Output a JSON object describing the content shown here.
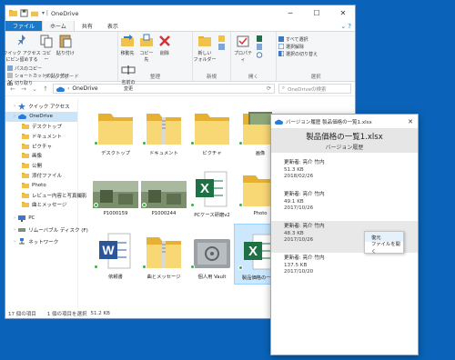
{
  "explorer": {
    "title": "OneDrive",
    "ribbon_tabs": [
      "ファイル",
      "ホーム",
      "共有",
      "表示"
    ],
    "ribbon": {
      "clipboard": {
        "pin": "クイック アクセス\nにピン留めする",
        "copy": "コピー",
        "paste": "貼り付け",
        "copy_path": "パスのコピー",
        "paste_shortcut": "ショートカットの貼り付け",
        "cut": "切り取り",
        "label": "クリップボード"
      },
      "organize": {
        "move": "移動先",
        "copyto": "コピー先",
        "delete": "削除",
        "rename": "名前の\n変更",
        "label": "整理"
      },
      "new": {
        "folder": "新しい\nフォルダー",
        "label": "新規"
      },
      "open": {
        "properties": "プロパティ",
        "label": "開く"
      },
      "select": {
        "all": "すべて選択",
        "none": "選択解除",
        "invert": "選択の切り替え",
        "label": "選択"
      }
    },
    "address": {
      "path": "OneDrive",
      "search_placeholder": "OneDriveの検索"
    },
    "nav": [
      {
        "label": "クイック アクセス",
        "icon": "star-icon",
        "top": true
      },
      {
        "label": "OneDrive",
        "icon": "cloud-icon",
        "top": true,
        "selected": true
      },
      {
        "label": "デスクトップ",
        "icon": "folder-icon"
      },
      {
        "label": "ドキュメント",
        "icon": "folder-icon"
      },
      {
        "label": "ピクチャ",
        "icon": "folder-icon"
      },
      {
        "label": "画像",
        "icon": "folder-icon"
      },
      {
        "label": "公開",
        "icon": "folder-icon"
      },
      {
        "label": "添付ファイル",
        "icon": "folder-icon"
      },
      {
        "label": "Photo",
        "icon": "folder-icon"
      },
      {
        "label": "レビュー内容と写真撮影",
        "icon": "folder-icon"
      },
      {
        "label": "曲とメッセージ",
        "icon": "folder-icon"
      },
      {
        "label": "PC",
        "icon": "pc-icon",
        "top": true
      },
      {
        "label": "リムーバブル ディスク (F)",
        "icon": "drive-icon",
        "top": true
      },
      {
        "label": "ネットワーク",
        "icon": "network-icon",
        "top": true
      }
    ],
    "files": [
      {
        "label": "デスクトップ",
        "type": "folder"
      },
      {
        "label": "ドキュメント",
        "type": "zipfolder"
      },
      {
        "label": "ピクチャ",
        "type": "folder"
      },
      {
        "label": "画像",
        "type": "photofolder"
      },
      {
        "label": "P1000159",
        "type": "photo"
      },
      {
        "label": "P1000244",
        "type": "photo"
      },
      {
        "label": "PCケース研磨v2",
        "type": "excel"
      },
      {
        "label": "Photo",
        "type": "folder"
      },
      {
        "label": "依頼書",
        "type": "word"
      },
      {
        "label": "曲とメッセージ",
        "type": "zipfolder"
      },
      {
        "label": "個人用 Vault",
        "type": "vault"
      },
      {
        "label": "製品価格の一覧1",
        "type": "excel",
        "selected": true
      }
    ],
    "status": {
      "count": "17 個の項目",
      "selection": "1 個の項目を選択",
      "size": "51.2 KB"
    }
  },
  "version_history": {
    "window_title": "バージョン履歴 製品価格の一覧1.xlsx",
    "file_name": "製品価格の一覧1.xlsx",
    "subtitle": "バージョン履歴",
    "entries": [
      {
        "editor": "更新者: 亮介 竹内",
        "size": "51.3 KB",
        "date": "2018/02/26"
      },
      {
        "editor": "更新者: 亮介 竹内",
        "size": "49.1 KB",
        "date": "2017/10/26"
      },
      {
        "editor": "更新者: 亮介 竹内",
        "size": "48.3 KB",
        "date": "2017/10/26",
        "selected": true
      },
      {
        "editor": "更新者: 亮介 竹内",
        "size": "137.5 KB",
        "date": "2017/10/20"
      }
    ],
    "context_menu": [
      "復元",
      "ファイルを開く"
    ]
  },
  "colors": {
    "accent": "#1979ca",
    "desktop": "#0a63b8",
    "folder": "#f8d775",
    "excel": "#1e7145",
    "word": "#2b579a",
    "sync_ok": "#3cb043"
  }
}
